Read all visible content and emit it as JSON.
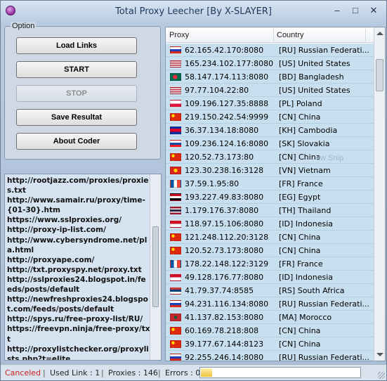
{
  "window": {
    "title": "Total Proxy Leecher [By X-SLAYER]",
    "minimize": "–",
    "maximize": "□",
    "close": "✕"
  },
  "option": {
    "legend": "Option",
    "buttons": {
      "load_links": "Load Links",
      "start": "START",
      "stop": "STOP",
      "save_result": "Save Resultat",
      "about": "About Coder"
    }
  },
  "links_text": "http://rootjazz.com/proxies/proxies.txt\nhttp://www.samair.ru/proxy/time-{01-30}.htm\nhttps://www.sslproxies.org/\nhttp://proxy-ip-list.com/\nhttp://www.cybersyndrome.net/pla.html\nhttp://proxyape.com/\nhttp://txt.proxyspy.net/proxy.txt\nhttp://sslproxies24.blogspot.in/feeds/posts/default\nhttp://newfreshproxies24.blogspot.com/feeds/posts/default\nhttp://spys.ru/free-proxy-list/RU/\nhttps://freevpn.ninja/free-proxy/txt\nhttp://proxylistchecker.org/proxylists.php?t=elite\nhttp://proxylistchecker.org/proxylists.p",
  "list": {
    "columns": {
      "proxy": "Proxy",
      "country": "Country"
    },
    "ghost": "ow Snip",
    "rows": [
      {
        "proxy": "62.165.42.170:8080",
        "country": "[RU] Russian Federati...",
        "flag": "ru"
      },
      {
        "proxy": "165.234.102.177:8080",
        "country": "[US] United States",
        "flag": "us"
      },
      {
        "proxy": "58.147.174.113:8080",
        "country": "[BD] Bangladesh",
        "flag": "bd"
      },
      {
        "proxy": "97.77.104.22:80",
        "country": "[US] United States",
        "flag": "us"
      },
      {
        "proxy": "109.196.127.35:8888",
        "country": "[PL] Poland",
        "flag": "pl"
      },
      {
        "proxy": "219.150.242.54:9999",
        "country": "[CN] China",
        "flag": "cn"
      },
      {
        "proxy": "36.37.134.18:8080",
        "country": "[KH] Cambodia",
        "flag": "kh"
      },
      {
        "proxy": "109.236.124.16:8080",
        "country": "[SK] Slovakia",
        "flag": "sk"
      },
      {
        "proxy": "120.52.73.173:80",
        "country": "[CN] China",
        "flag": "cn"
      },
      {
        "proxy": "123.30.238.16:3128",
        "country": "[VN] Vietnam",
        "flag": "vn"
      },
      {
        "proxy": "37.59.1.95:80",
        "country": "[FR] France",
        "flag": "fr"
      },
      {
        "proxy": "193.227.49.83:8080",
        "country": "[EG] Egypt",
        "flag": "eg"
      },
      {
        "proxy": "1.179.176.37:8080",
        "country": "[TH] Thailand",
        "flag": "th"
      },
      {
        "proxy": "118.97.15.106:8080",
        "country": "[ID] Indonesia",
        "flag": "id"
      },
      {
        "proxy": "121.248.112.20:3128",
        "country": "[CN] China",
        "flag": "cn"
      },
      {
        "proxy": "120.52.73.173:8080",
        "country": "[CN] China",
        "flag": "cn"
      },
      {
        "proxy": "178.22.148.122:3129",
        "country": "[FR] France",
        "flag": "fr"
      },
      {
        "proxy": "49.128.176.77:8080",
        "country": "[ID] Indonesia",
        "flag": "id"
      },
      {
        "proxy": "41.79.37.74:8585",
        "country": "[RS] South Africa",
        "flag": "rs"
      },
      {
        "proxy": "94.231.116.134:8080",
        "country": "[RU] Russian Federati...",
        "flag": "ru"
      },
      {
        "proxy": "41.137.82.153:8080",
        "country": "[MA] Morocco",
        "flag": "ma"
      },
      {
        "proxy": "60.169.78.218:808",
        "country": "[CN] China",
        "flag": "cn"
      },
      {
        "proxy": "39.177.67.144:8123",
        "country": "[CN] China",
        "flag": "cn"
      },
      {
        "proxy": "92.255.246.14:8080",
        "country": "[RU] Russian Federati...",
        "flag": "ru"
      }
    ]
  },
  "status": {
    "state": "Canceled",
    "used_link": "Used Link : 1",
    "proxies": "Proxies : 146",
    "errors": "Errors : 0",
    "separator": "|",
    "progress_fraction": 0.07
  },
  "colors": {
    "canceled": "#cc1f1f",
    "row_bg": "#c8dfef"
  }
}
